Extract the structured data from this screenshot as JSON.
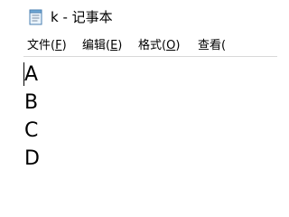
{
  "window": {
    "title": "k - 记事本",
    "app_icon": "notepad-icon"
  },
  "menu": {
    "items": [
      {
        "label_main": "文件(",
        "accelerator": "F",
        "label_end": ")"
      },
      {
        "label_main": "编辑(",
        "accelerator": "E",
        "label_end": ")"
      },
      {
        "label_main": "格式(",
        "accelerator": "O",
        "label_end": ")"
      },
      {
        "label_main": "查看(",
        "accelerator": "",
        "label_end": ""
      }
    ]
  },
  "document": {
    "lines": [
      "A",
      "B",
      "C",
      "D"
    ]
  }
}
